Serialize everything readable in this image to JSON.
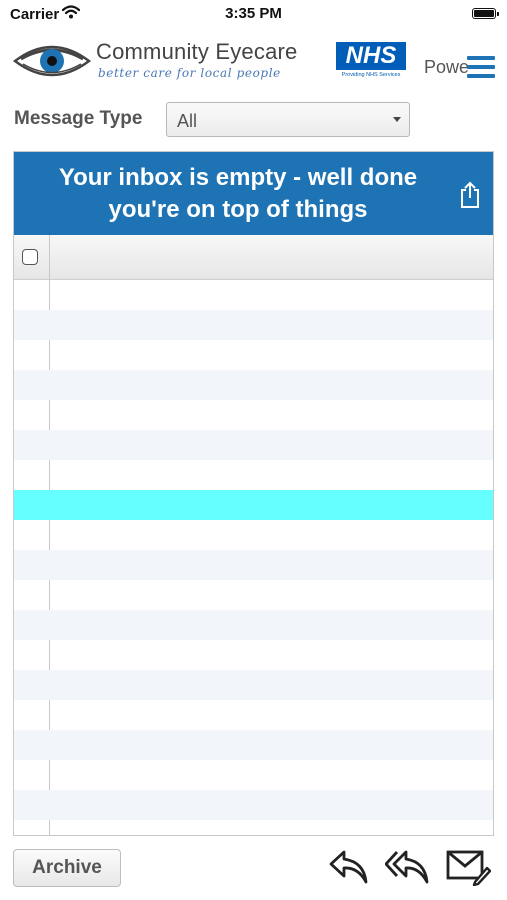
{
  "status_bar": {
    "carrier": "Carrier",
    "time": "3:35 PM"
  },
  "header": {
    "brand_name": "Community Eyecare",
    "brand_tagline": "better care for local people",
    "nhs_logo_text": "NHS",
    "nhs_logo_subtext": "Providing NHS Services",
    "powered_text": "Powe",
    "brand_color": "#1e73b4",
    "nhs_color": "#005eb8"
  },
  "filter": {
    "label": "Message Type",
    "selected": "All"
  },
  "inbox": {
    "empty_message": "Your inbox is empty - well done you're on top of things",
    "banner_color": "#1e73b4",
    "highlight_color": "#66ffff",
    "row_count": 18,
    "selected_row_index": 7
  },
  "toolbar": {
    "archive_label": "Archive",
    "icons": [
      "reply-icon",
      "reply-all-icon",
      "compose-icon"
    ]
  }
}
